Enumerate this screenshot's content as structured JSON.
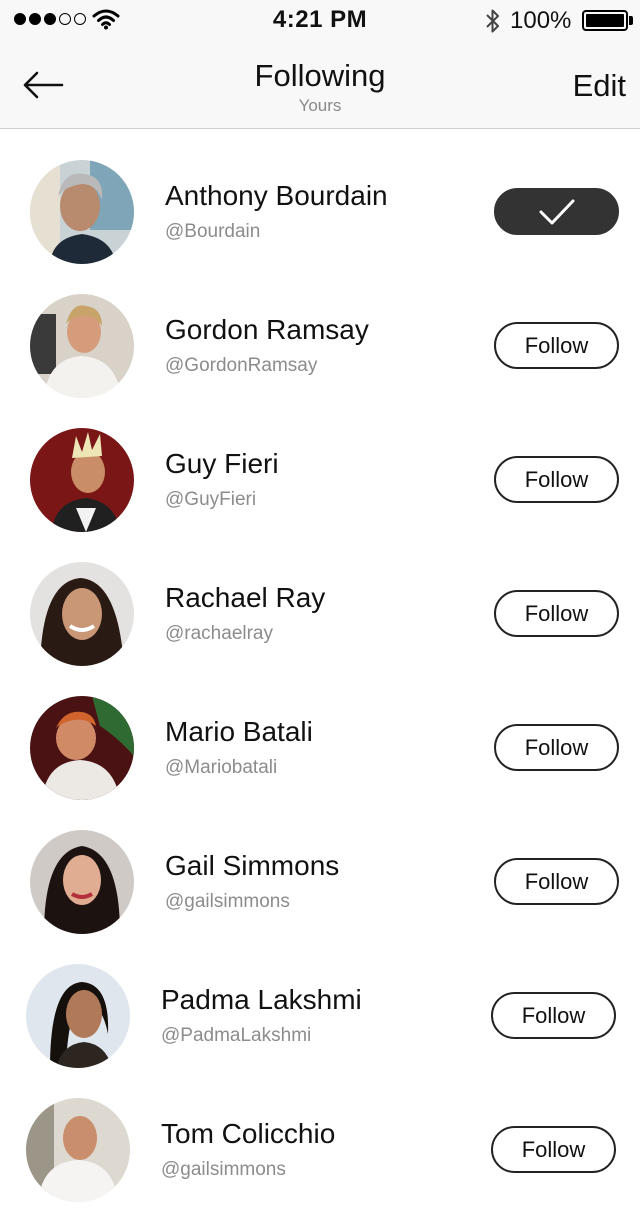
{
  "status_bar": {
    "time": "4:21 PM",
    "battery": "100%",
    "signal_dots_filled": 3,
    "signal_dots_total": 5,
    "icons": [
      "wifi-icon",
      "bluetooth-icon",
      "battery-icon"
    ]
  },
  "nav": {
    "title": "Following",
    "subtitle": "Yours",
    "edit_label": "Edit",
    "back_icon": "arrow-left-icon"
  },
  "colors": {
    "following_button": "#333333",
    "handle_text": "#8c8c8c",
    "bar_background": "#f8f8f8"
  },
  "people": [
    {
      "name": "Anthony Bourdain",
      "handle": "@Bourdain",
      "following": true,
      "button_label": ""
    },
    {
      "name": "Gordon Ramsay",
      "handle": "@GordonRamsay",
      "following": false,
      "button_label": "Follow"
    },
    {
      "name": "Guy Fieri",
      "handle": "@GuyFieri",
      "following": false,
      "button_label": "Follow"
    },
    {
      "name": "Rachael Ray",
      "handle": "@rachaelray",
      "following": false,
      "button_label": "Follow"
    },
    {
      "name": "Mario Batali",
      "handle": "@Mariobatali",
      "following": false,
      "button_label": "Follow"
    },
    {
      "name": "Gail Simmons",
      "handle": "@gailsimmons",
      "following": false,
      "button_label": "Follow"
    },
    {
      "name": "Padma Lakshmi",
      "handle": "@PadmaLakshmi",
      "following": false,
      "button_label": "Follow"
    },
    {
      "name": "Tom Colicchio",
      "handle": "@gailsimmons",
      "following": false,
      "button_label": "Follow"
    }
  ]
}
